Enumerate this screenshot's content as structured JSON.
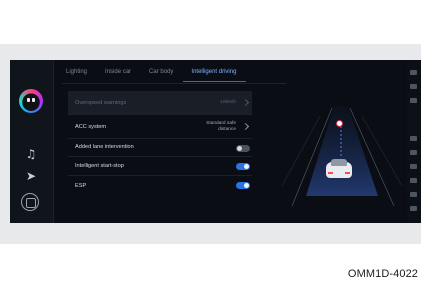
{
  "tabs": [
    {
      "label": "Lighting",
      "active": false
    },
    {
      "label": "Inside car",
      "active": false
    },
    {
      "label": "Car body",
      "active": false
    },
    {
      "label": "Intelligent driving",
      "active": true
    }
  ],
  "settings": {
    "overspeed_warnings": {
      "label": "Overspeed warnings",
      "value": "10km/h",
      "enabled": false
    },
    "acc_system": {
      "label": "ACC system",
      "value_line1": "Standard safe",
      "value_line2": "distance"
    },
    "lane_intervention": {
      "label": "Added lane intervention",
      "state": "off"
    },
    "start_stop": {
      "label": "Intelligent start-stop",
      "state": "on"
    },
    "esp": {
      "label": "ESP",
      "state": "on"
    }
  },
  "icons": {
    "assistant": "voice-assistant-icon",
    "music": "music-note-icon",
    "navigation": "navigation-arrow-icon",
    "home": "home-icon"
  },
  "colors": {
    "accent": "#2b72e3",
    "active_tab": "#7fb4ff",
    "screen_bg": "#0a0d13"
  },
  "caption": "OMM1D-4022"
}
